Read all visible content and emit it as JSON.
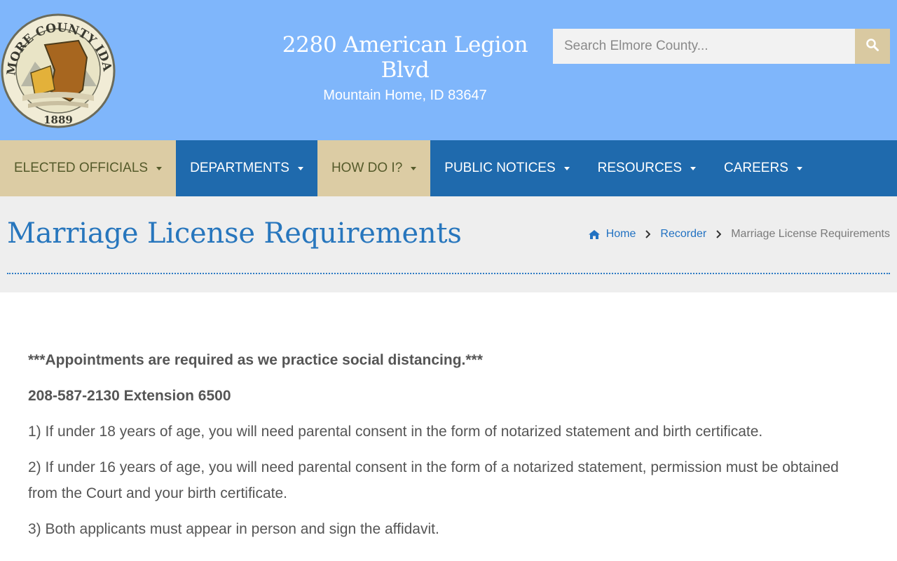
{
  "header": {
    "seal_text_top": "ELMORE COUNTY IDAHO",
    "seal_year": "1889",
    "address_line1": "2280 American Legion Blvd",
    "address_line2": "Mountain Home, ID 83647",
    "search_placeholder": "Search Elmore County..."
  },
  "colors": {
    "header_bg": "#7fb6fb",
    "nav_bg": "#1f6aad",
    "nav_tan": "#dccca4",
    "accent": "#2776bd"
  },
  "nav": {
    "items": [
      {
        "label": "ELECTED OFFICIALS",
        "style": "tan"
      },
      {
        "label": "DEPARTMENTS",
        "style": "blue"
      },
      {
        "label": "HOW DO I?",
        "style": "tan"
      },
      {
        "label": "PUBLIC NOTICES",
        "style": "blue"
      },
      {
        "label": "RESOURCES",
        "style": "blue"
      },
      {
        "label": "CAREERS",
        "style": "blue"
      }
    ]
  },
  "page": {
    "title": "Marriage License Requirements",
    "breadcrumb": {
      "home": "Home",
      "parent": "Recorder",
      "current": "Marriage License Requirements"
    }
  },
  "content": {
    "notice": "***Appointments are required as we practice social distancing.***",
    "phone": "208-587-2130 Extension 6500",
    "items": [
      "1) If under 18 years of age, you will need parental consent in the form of notarized statement and birth certificate.",
      "2) If under 16 years of age, you will need parental consent in the form of a notarized statement, permission must be obtained from the Court and your birth certificate.",
      "3) Both applicants must appear in person and sign the affidavit."
    ]
  }
}
